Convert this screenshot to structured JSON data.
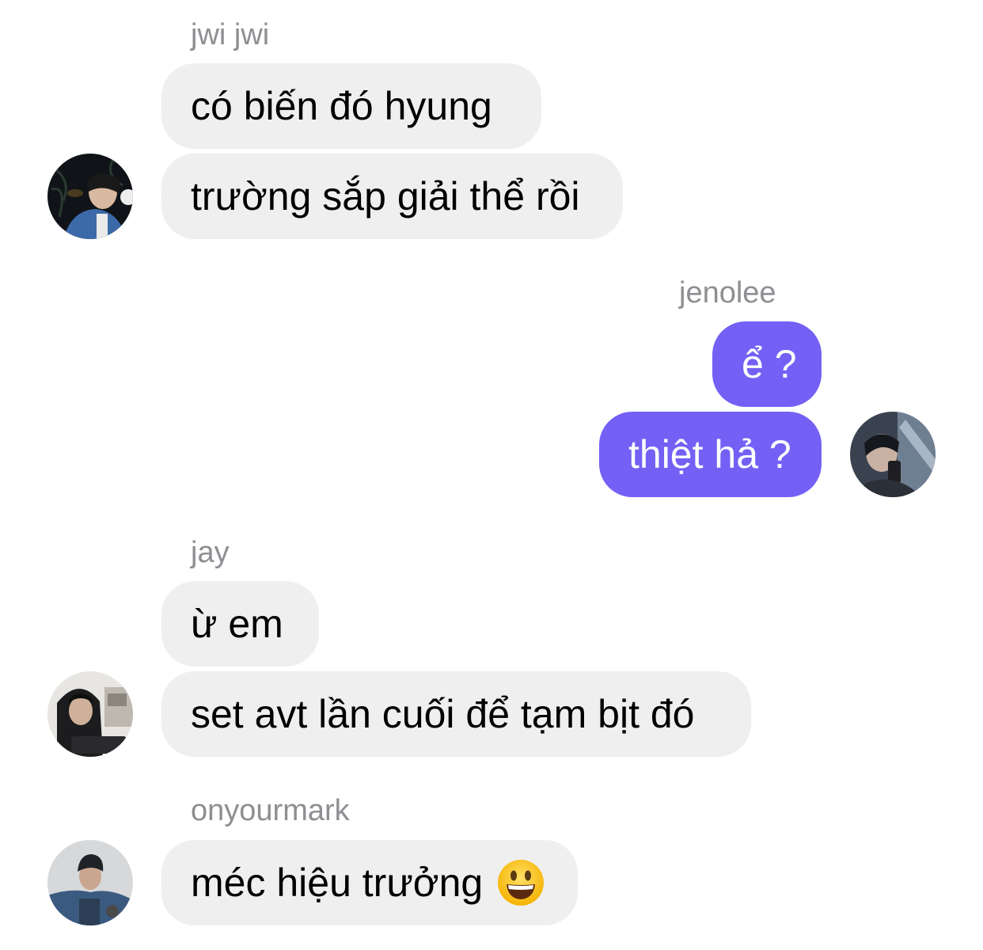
{
  "messages": [
    {
      "sender": "jwi jwi",
      "lines": [
        "có biến đó hyung",
        "trường sắp giải thể rồi"
      ]
    },
    {
      "sender": "jenolee",
      "lines": [
        "ể ?",
        "thiệt hả ?"
      ]
    },
    {
      "sender": "jay",
      "lines": [
        "ừ em",
        "set avt lần cuối để tạm bịt đó"
      ]
    },
    {
      "sender": "onyourmark",
      "lines": [
        "méc hiệu trưởng"
      ],
      "emoji": "grinning-face-emoji"
    }
  ],
  "colors": {
    "outgoing_bubble": "#7460f5",
    "incoming_bubble": "#efefef",
    "sender_name": "#8e8e93"
  }
}
